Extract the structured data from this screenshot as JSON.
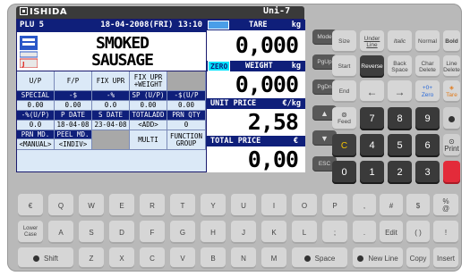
{
  "brand": "ISHIDA",
  "model": "Uni-7",
  "screen": {
    "plu_label": "PLU 5",
    "datetime": "18-04-2008(FRI) 13:10",
    "product_line1": "SMOKED",
    "product_line2": "SAUSAGE",
    "grid": [
      [
        "U/P",
        "F/P",
        "FIX UPR",
        "FIX UPR +WEIGHT",
        ""
      ],
      [
        "SPECIAL",
        "-$",
        "-%",
        "SP (U/P)",
        "-$(U/P"
      ],
      [
        "0.00",
        "0.00",
        "0.0",
        "0.00",
        "0.00"
      ],
      [
        "-%(U/P)",
        "P DATE",
        "S DATE",
        "TOTALADD",
        "PRN QTY"
      ],
      [
        "0.0",
        "18-04-08",
        "23-04-08",
        "<ADD>",
        "0"
      ],
      [
        "PRN MD.",
        "PEEL MD.",
        "",
        "MULTI",
        "FUNCTION GROUP"
      ],
      [
        "<MANUAL>",
        "<INDIV>",
        "",
        "",
        ""
      ]
    ],
    "tare_label": "TARE",
    "tare_unit": "kg",
    "tare_value": "0,000",
    "zero_label": "ZERO",
    "weight_label": "WEIGHT",
    "weight_unit": "kg",
    "weight_value": "0,000",
    "unit_price_label": "UNIT PRICE",
    "unit_price_unit": "€/kg",
    "unit_price_value": "2,58",
    "total_price_label": "TOTAL PRICE",
    "total_price_unit": "€",
    "total_price_value": "0,00"
  },
  "side_keys": [
    "Mode",
    "PgUp",
    "PgDn",
    "▲",
    "▼",
    "ESC"
  ],
  "func_keys": {
    "row1": [
      "Size",
      "Under Line",
      "Italic",
      "Normal",
      "Bold"
    ],
    "row2": [
      "Start",
      "Reverse",
      "Back Space",
      "Char Delete",
      "Line Delete"
    ],
    "row3": [
      "End",
      "←",
      "→",
      "+0+ Zero",
      "Tare"
    ],
    "row4": [
      "Feed",
      "7",
      "8",
      "9",
      ""
    ],
    "row5": [
      "C",
      "4",
      "5",
      "6",
      "Print"
    ],
    "row6": [
      "0",
      "1",
      "2",
      "3",
      "PLU"
    ]
  },
  "keyboard": {
    "row1": [
      "€",
      "Q",
      "W",
      "E",
      "R",
      "T",
      "Y",
      "U",
      "I",
      "O",
      "P",
      ",",
      "#",
      "$",
      "%",
      "*"
    ],
    "row1_sub": {
      "14": "@",
      "15": "&"
    },
    "row2": [
      "Lower Case",
      "A",
      "S",
      "D",
      "F",
      "G",
      "H",
      "J",
      "K",
      "L",
      ";",
      ".",
      "Edit",
      "( )",
      "\" ,",
      "!"
    ],
    "row3": [
      "Shift",
      "Z",
      "X",
      "C",
      "V",
      "B",
      "N",
      "M",
      "Space",
      "New Line",
      "Copy",
      "Insert",
      "Enter"
    ]
  },
  "colors": {
    "screen_bg": "#dbe9f7",
    "header_blue": "#0f1f7a",
    "zero_cyan": "#00e5ff",
    "plu_red": "#e32b3a"
  }
}
